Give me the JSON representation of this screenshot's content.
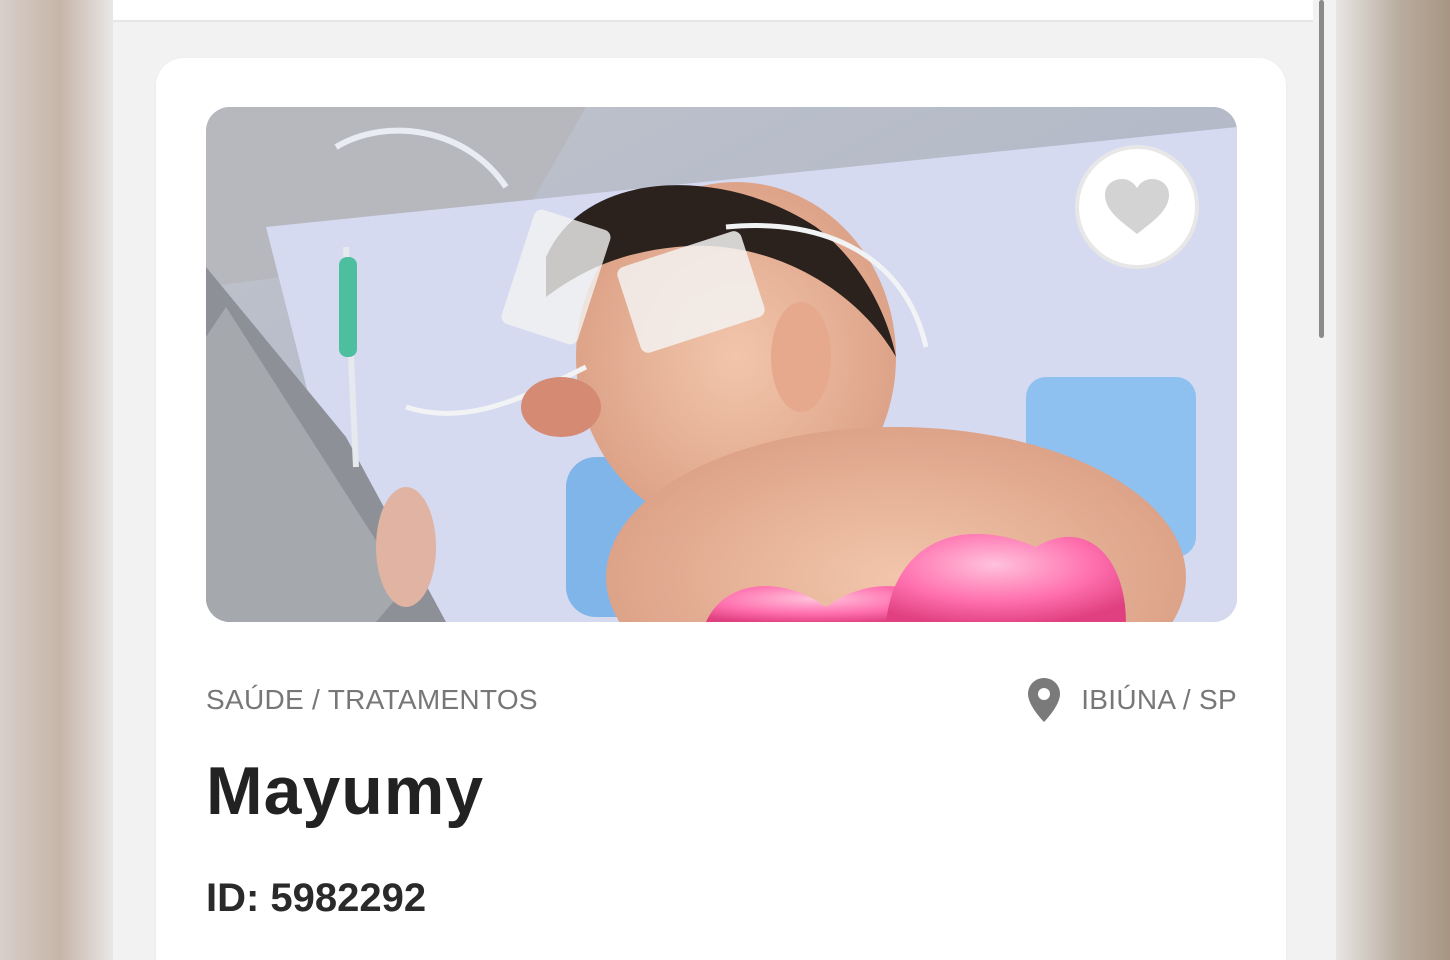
{
  "card": {
    "image_alt": "Bebê internado",
    "category": "SAÚDE / TRATAMENTOS",
    "location": "IBIÚNA / SP",
    "title": "Mayumy",
    "id_label": "ID: 5982292"
  },
  "icons": {
    "favorite": "heart-icon",
    "location": "map-pin-icon"
  },
  "colors": {
    "card_bg": "#ffffff",
    "page_bg": "#f2f2f2",
    "muted_text": "#777777",
    "title_text": "#222222",
    "heart_fill": "#d3d3d3"
  }
}
